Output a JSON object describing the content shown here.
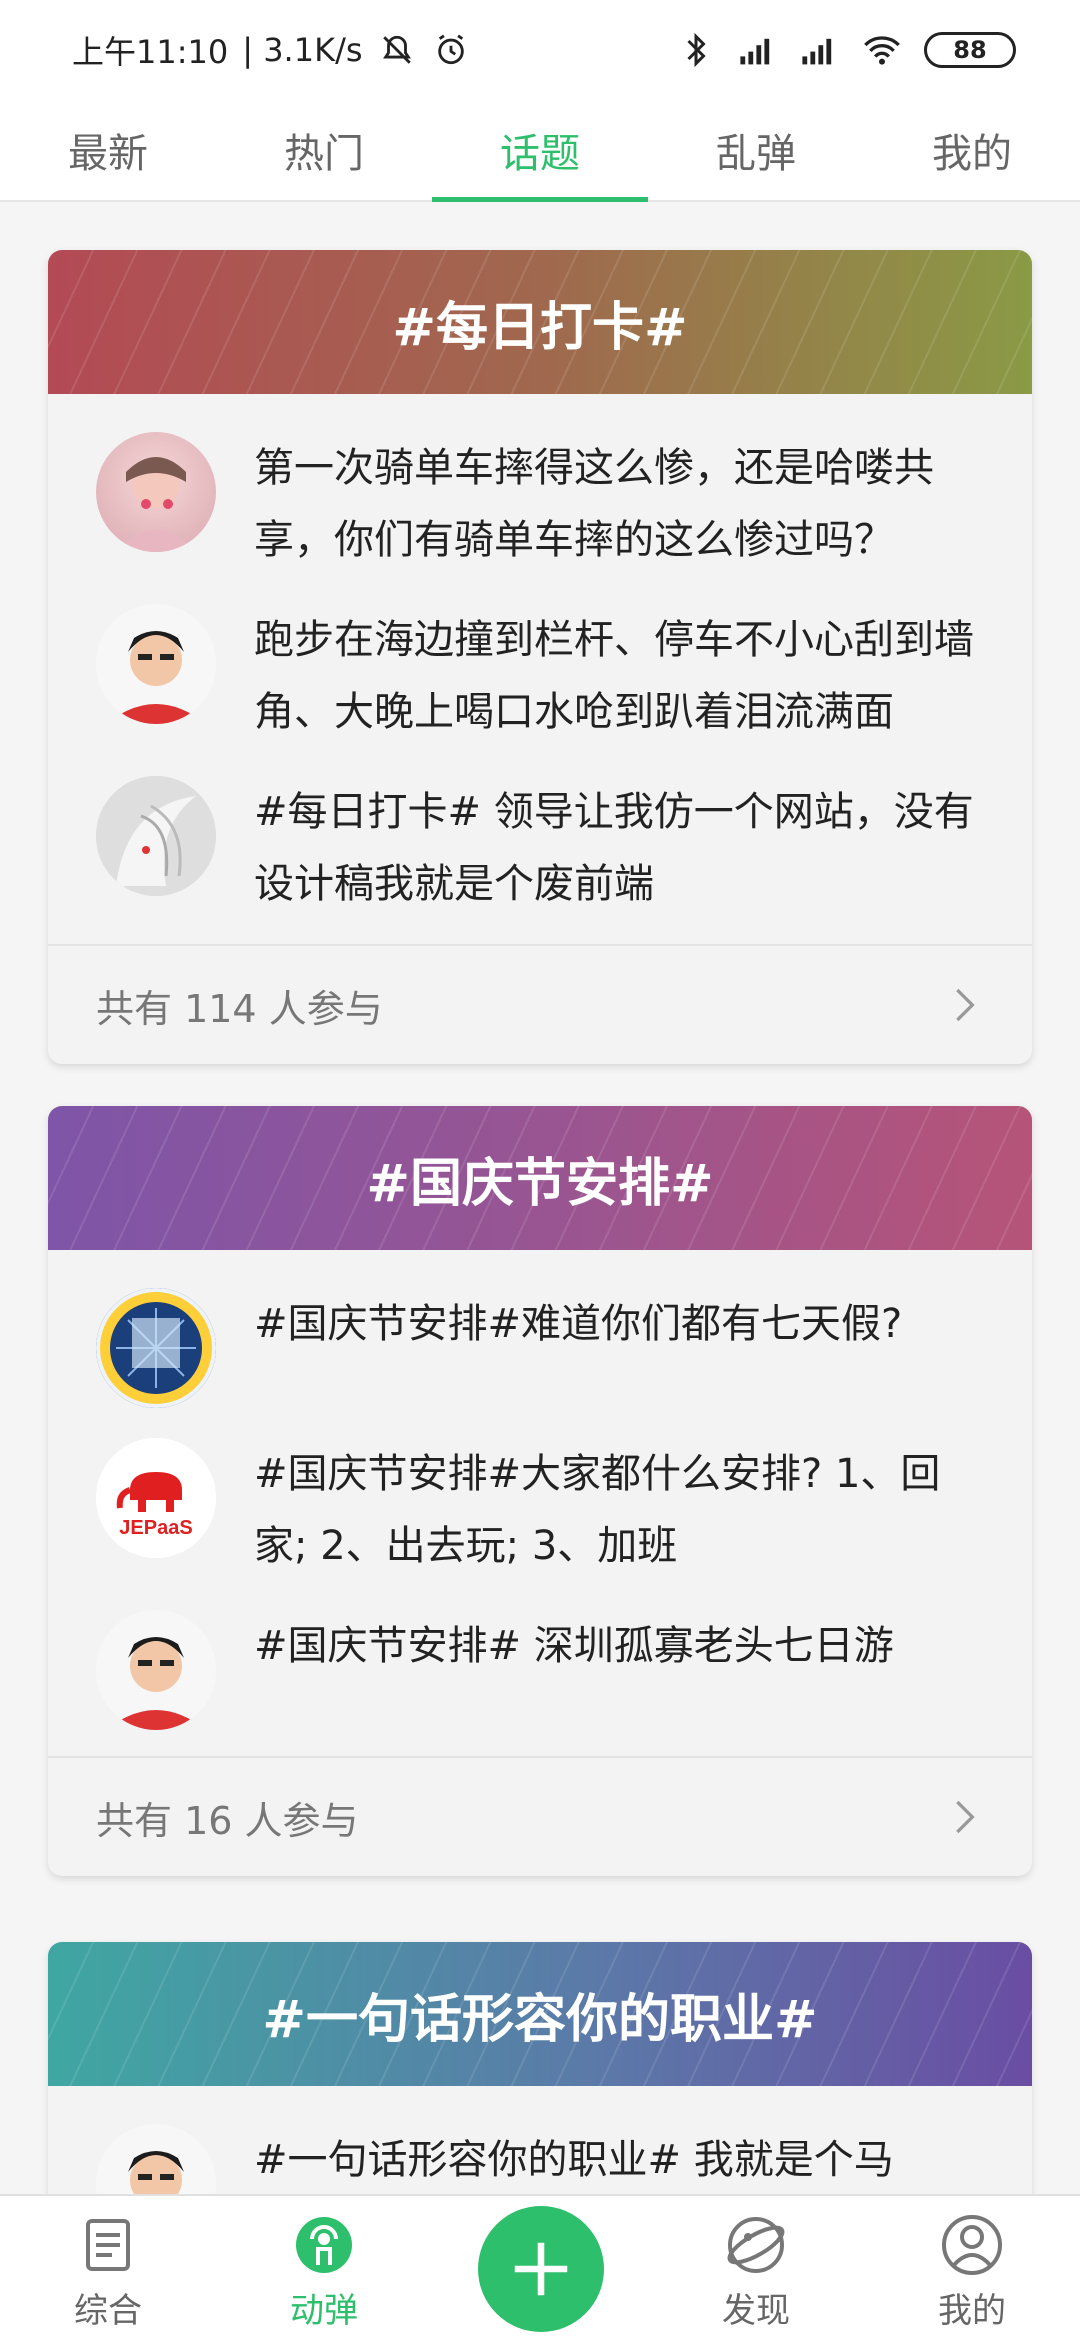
{
  "status_bar": {
    "time": "上午11:10",
    "net_speed": "| 3.1K/s",
    "battery": "88"
  },
  "top_tabs": [
    {
      "label": "最新",
      "active": false
    },
    {
      "label": "热门",
      "active": false
    },
    {
      "label": "话题",
      "active": true
    },
    {
      "label": "乱弹",
      "active": false
    },
    {
      "label": "我的",
      "active": false
    }
  ],
  "topics": [
    {
      "title": "#每日打卡#",
      "posts": [
        {
          "text": "第一次骑单车摔得这么惨，还是哈喽共享，你们有骑单车摔的这么惨过吗？"
        },
        {
          "text": "跑步在海边撞到栏杆、停车不小心刮到墙角、大晚上喝口水呛到趴着泪流满面"
        },
        {
          "text": "#每日打卡# 领导让我仿一个网站，没有设计稿我就是个废前端"
        }
      ],
      "participants": "共有 114 人参与"
    },
    {
      "title": "#国庆节安排#",
      "posts": [
        {
          "text": "#国庆节安排#难道你们都有七天假?"
        },
        {
          "text": "#国庆节安排#大家都什么安排? 1、回家; 2、出去玩; 3、加班"
        },
        {
          "text": "#国庆节安排# 深圳孤寡老头七日游"
        }
      ],
      "participants": "共有 16 人参与"
    },
    {
      "title": "#一句话形容你的职业#",
      "posts": [
        {
          "text": "#一句话形容你的职业# 我就是个马"
        }
      ]
    }
  ],
  "bottom_nav": [
    {
      "label": "综合",
      "icon": "document-icon",
      "active": false
    },
    {
      "label": "动弹",
      "icon": "broadcast-icon",
      "active": true
    },
    {
      "label": "",
      "icon": "plus-icon",
      "active": false
    },
    {
      "label": "发现",
      "icon": "planet-icon",
      "active": false
    },
    {
      "label": "我的",
      "icon": "user-icon",
      "active": false
    }
  ],
  "colors": {
    "accent": "#2dbf6c",
    "header1_start": "#b34a55",
    "header1_end": "#8a9a45",
    "header2_start": "#7e55a8",
    "header2_end": "#b65478",
    "header3_start": "#3fa7a2",
    "header3_end": "#6a4da3"
  }
}
